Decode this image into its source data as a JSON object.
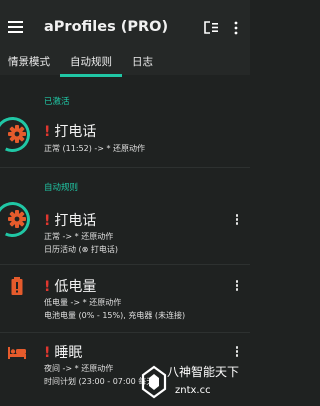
{
  "appbar": {
    "title": "aProfiles (PRO)",
    "menu_icon": "hamburger-menu-icon",
    "actions": [
      "priority-sort-icon",
      "more-vert-icon"
    ]
  },
  "tabs": [
    {
      "label": "情景模式",
      "selected": false
    },
    {
      "label": "自动规则",
      "selected": true
    },
    {
      "label": "日志",
      "selected": false
    }
  ],
  "sections": {
    "active": "已激活",
    "rules": "自动规则"
  },
  "cards": [
    {
      "icon": "gear-icon",
      "title": "打电话",
      "lines": [
        "正常 (11:52) -> * 还原动作"
      ],
      "ring": true,
      "menu": false
    },
    {
      "icon": "gear-icon",
      "title": "打电话",
      "lines": [
        "正常 -> * 还原动作",
        "日历活动 (⊗ 打电话)"
      ],
      "ring": true,
      "menu": true
    },
    {
      "icon": "battery-alert-icon",
      "title": "低电量",
      "lines": [
        "低电量 -> * 还原动作",
        "电池电量 (0% - 15%), 充电器 (未连接)"
      ],
      "ring": false,
      "menu": true
    },
    {
      "icon": "bed-icon",
      "title": "睡眠",
      "lines": [
        "夜间 -> * 还原动作",
        "时间计划 (23:00 - 07:00 每天)"
      ],
      "ring": false,
      "menu": true
    }
  ],
  "colors": {
    "accent": "#20c7a5",
    "icon_orange": "#e55b2c",
    "alert_red": "#e0372f",
    "background": "#1f2221",
    "bar": "#252827"
  },
  "watermark": {
    "line1": "八神智能天下",
    "line2": "zntx.cc"
  }
}
